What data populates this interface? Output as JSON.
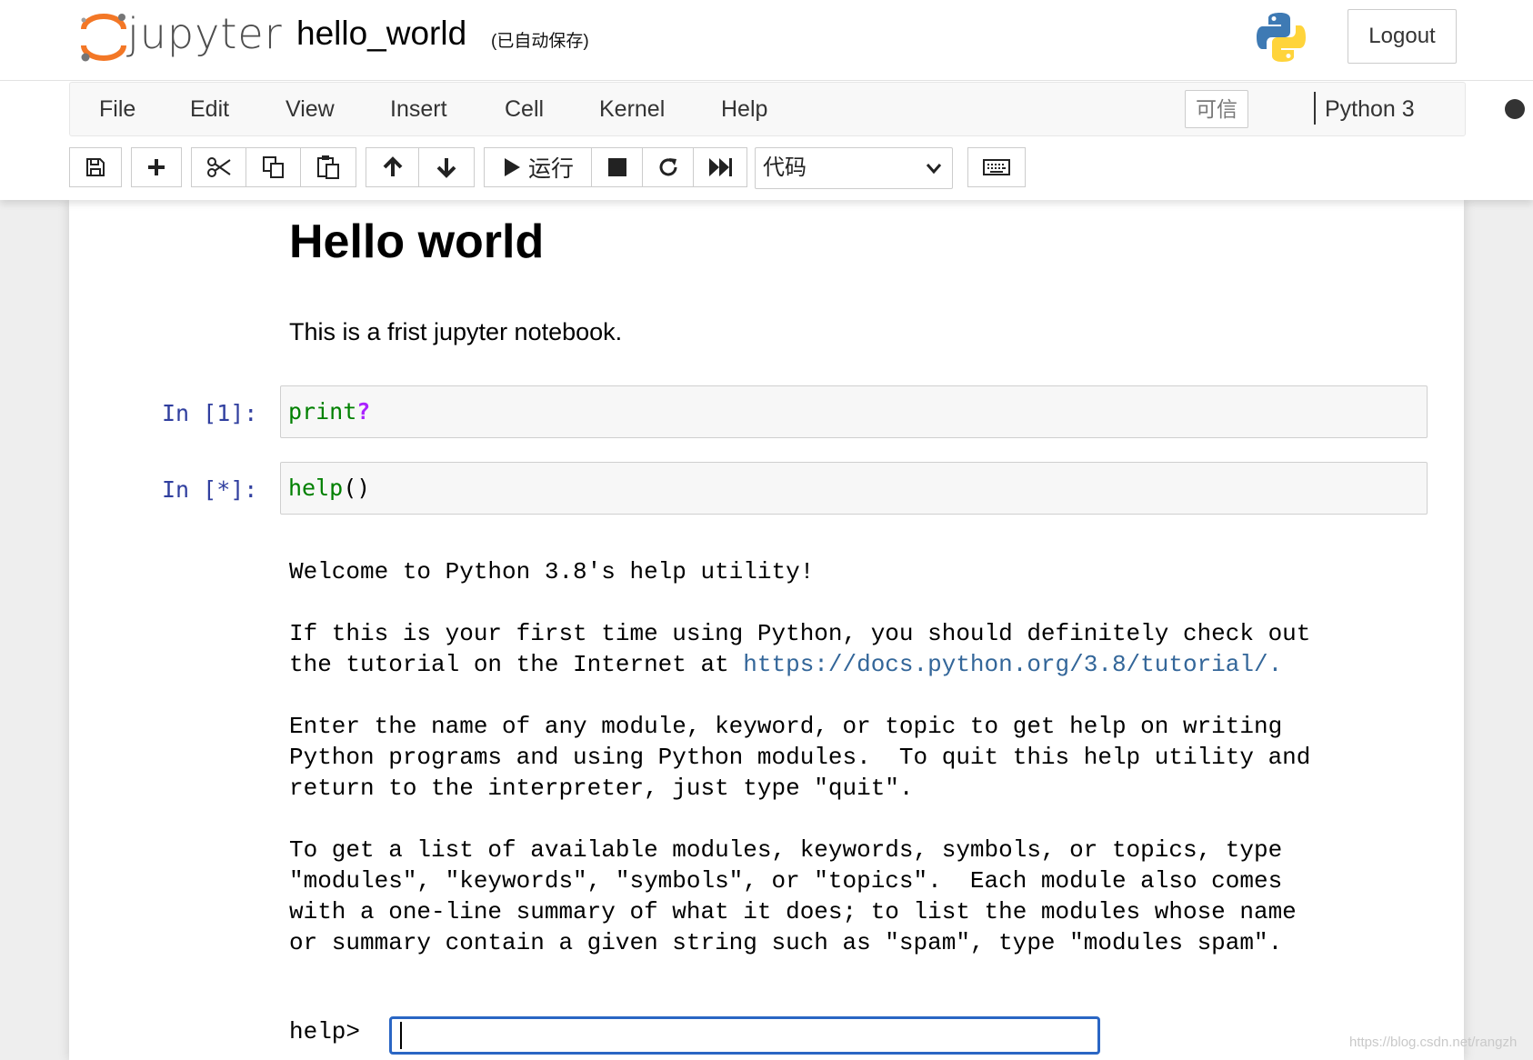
{
  "header": {
    "logo_text": "jupyter",
    "notebook_name": "hello_world",
    "autosave_status": "(已自动保存)",
    "logout_label": "Logout"
  },
  "menubar": {
    "items": [
      "File",
      "Edit",
      "View",
      "Insert",
      "Cell",
      "Kernel",
      "Help"
    ],
    "trusted_label": "可信",
    "kernel_name": "Python 3"
  },
  "toolbar": {
    "run_label": "运行",
    "cell_type_selected": "代码"
  },
  "notebook": {
    "markdown_title": "Hello world",
    "markdown_text": "This is a frist jupyter notebook.",
    "cells": [
      {
        "prompt": "In [1]:",
        "func": "print",
        "suffix": "?"
      },
      {
        "prompt": "In [*]:",
        "func": "help",
        "suffix": "()"
      }
    ],
    "output_lines": [
      "Welcome to Python 3.8's help utility!",
      "",
      "If this is your first time using Python, you should definitely check out",
      "the tutorial on the Internet at ",
      "",
      "Enter the name of any module, keyword, or topic to get help on writing",
      "Python programs and using Python modules.  To quit this help utility and",
      "return to the interpreter, just type \"quit\".",
      "",
      "To get a list of available modules, keywords, symbols, or topics, type",
      "\"modules\", \"keywords\", \"symbols\", or \"topics\".  Each module also comes",
      "with a one-line summary of what it does; to list the modules whose name",
      "or summary contain a given string such as \"spam\", type \"modules spam\"."
    ],
    "tutorial_link": "https://docs.python.org/3.8/tutorial/.",
    "help_prompt": "help>",
    "help_input_value": ""
  },
  "watermark": "https://blog.csdn.net/rangzh",
  "colors": {
    "prompt": "#303f9f",
    "keyword": "#008000",
    "operator": "#aa22ff",
    "link": "#336699",
    "input_focus": "#2a66c4",
    "logo_orange": "#f37726"
  }
}
